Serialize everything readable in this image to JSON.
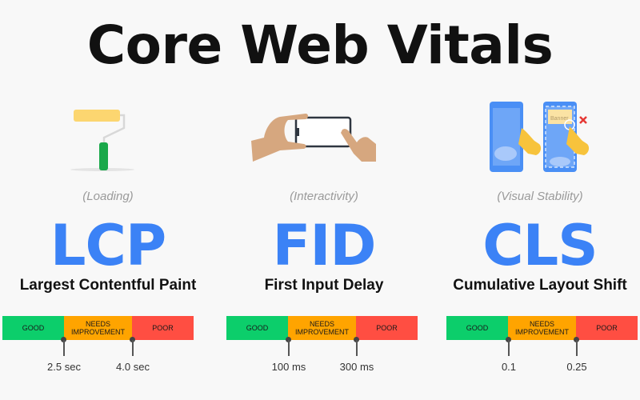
{
  "title": "Core Web Vitals",
  "metrics": [
    {
      "category": "(Loading)",
      "abbr": "LCP",
      "name": "Largest Contentful Paint",
      "illustration": "paint-roller-icon",
      "segments": [
        "GOOD",
        "NEEDS IMPROVEMENT",
        "POOR"
      ],
      "thresholds": [
        "2.5 sec",
        "4.0 sec"
      ]
    },
    {
      "category": "(Interactivity)",
      "abbr": "FID",
      "name": "First Input Delay",
      "illustration": "hands-phone-tap-icon",
      "segments": [
        "GOOD",
        "NEEDS IMPROVEMENT",
        "POOR"
      ],
      "thresholds": [
        "100 ms",
        "300 ms"
      ]
    },
    {
      "category": "(Visual Stability)",
      "abbr": "CLS",
      "name": "Cumulative Layout Shift",
      "illustration": "layout-shift-phones-icon",
      "banner_label": "Banner",
      "segments": [
        "GOOD",
        "NEEDS IMPROVEMENT",
        "POOR"
      ],
      "thresholds": [
        "0.1",
        "0.25"
      ]
    }
  ],
  "colors": {
    "good": "#0cce6b",
    "needs_improvement": "#ffa400",
    "poor": "#ff4e42",
    "accent": "#3b82f6"
  }
}
